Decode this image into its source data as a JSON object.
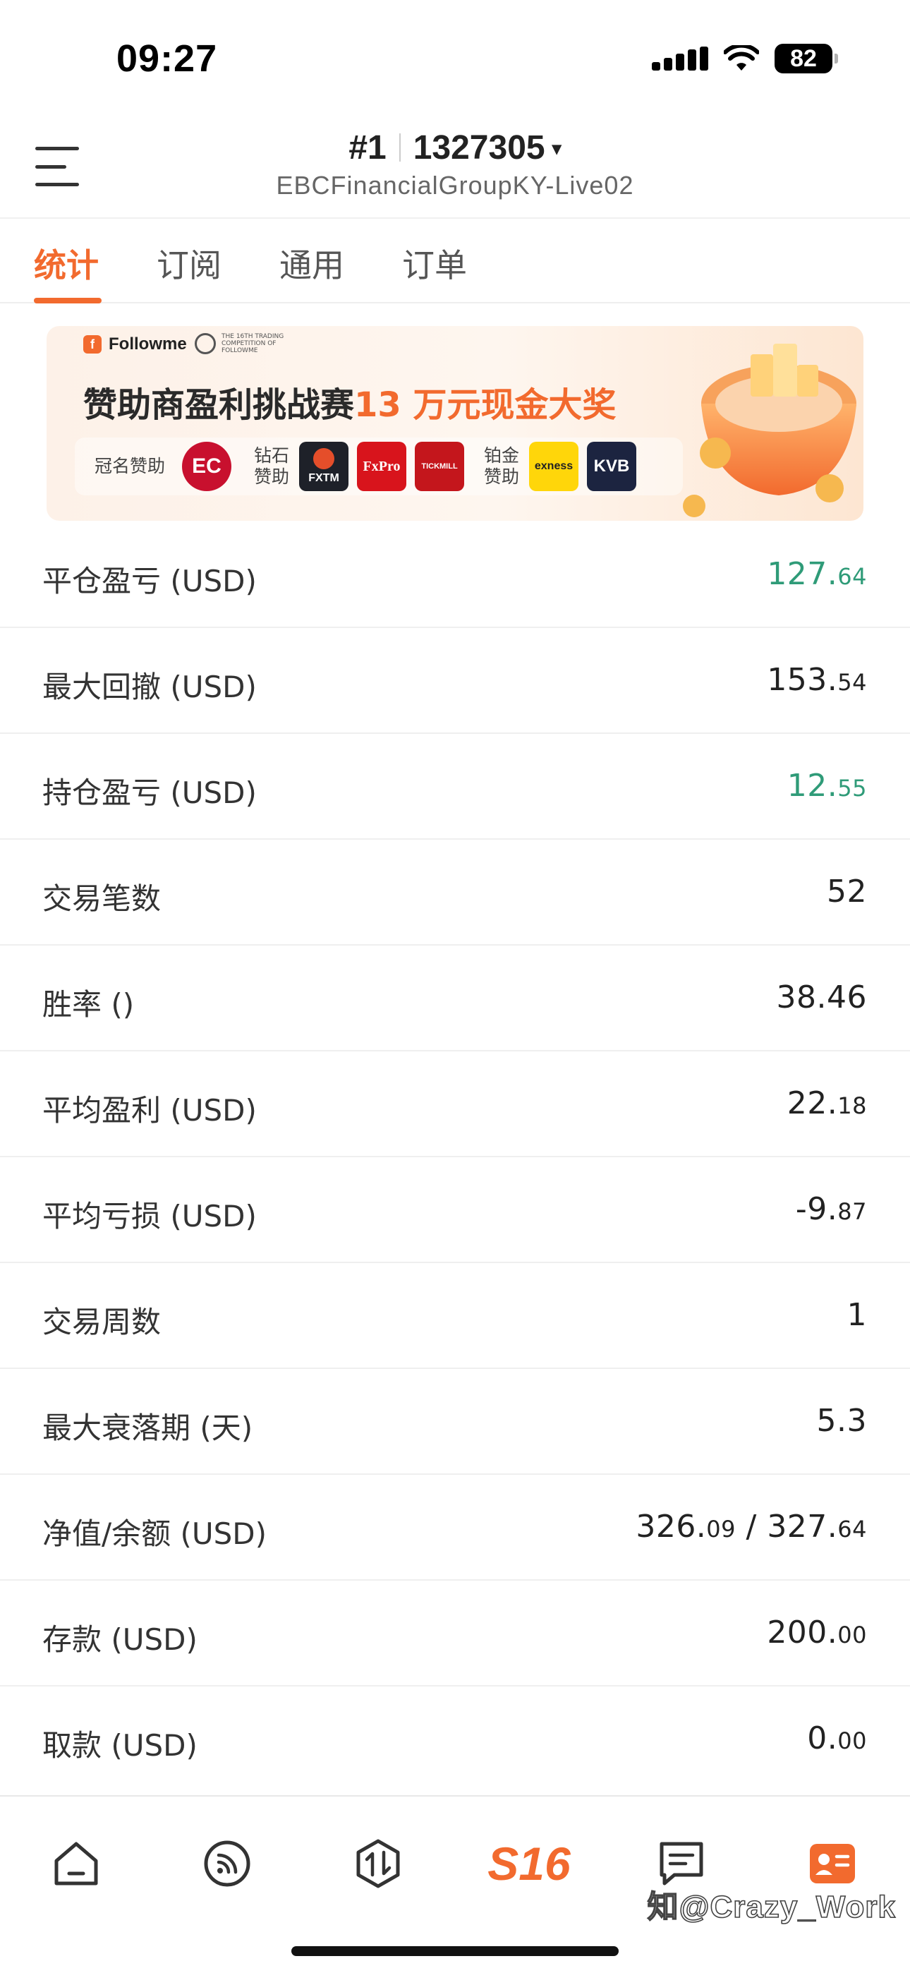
{
  "status_bar": {
    "time": "09:27",
    "battery": "82"
  },
  "header": {
    "account_prefix": "#1",
    "account_number": "1327305",
    "caret": "▾",
    "server": "EBCFinancialGroupKY-Live02"
  },
  "tabs": [
    {
      "label": "统计",
      "active": true
    },
    {
      "label": "订阅",
      "active": false
    },
    {
      "label": "通用",
      "active": false
    },
    {
      "label": "订单",
      "active": false
    }
  ],
  "banner": {
    "brand": "Followme",
    "competition_text": "THE 16TH TRADING COMPETITION OF FOLLOWME",
    "title_main": "赞助商盈利挑战赛",
    "title_highlight": "13 万元现金大奖",
    "title_sponsor_label": "冠名赞助",
    "diamond_label": "钻石赞助",
    "platinum_label": "铂金赞助",
    "sponsors": {
      "ec": "EC",
      "fxtm": "FXTM",
      "fxpro": "FxPro",
      "tickmill": "TICKMILL",
      "exness": "exness",
      "kvb": "KVB"
    }
  },
  "stats": [
    {
      "label": "平仓盈亏 (USD)",
      "int": "127.",
      "dec": "64",
      "color": "#2f9b78"
    },
    {
      "label": "最大回撤 (USD)",
      "int": "153.",
      "dec": "54",
      "color": "#222222"
    },
    {
      "label": "持仓盈亏 (USD)",
      "int": "12.",
      "dec": "55",
      "color": "#2f9b78"
    },
    {
      "label": "交易笔数",
      "int": "52",
      "dec": "",
      "color": "#222222"
    },
    {
      "label": "胜率 ()",
      "int": "38.46",
      "dec": "",
      "color": "#222222"
    },
    {
      "label": "平均盈利 (USD)",
      "int": "22.",
      "dec": "18",
      "color": "#222222"
    },
    {
      "label": "平均亏损 (USD)",
      "int": "-9.",
      "dec": "87",
      "color": "#222222"
    },
    {
      "label": "交易周数",
      "int": "1",
      "dec": "",
      "color": "#222222"
    },
    {
      "label": "最大衰落期 (天)",
      "int": "5.3",
      "dec": "",
      "color": "#222222"
    },
    {
      "label": "净值/余额 (USD)",
      "int": "326.",
      "dec": "09",
      "int2": " / 327.",
      "dec2": "64",
      "color": "#222222"
    },
    {
      "label": "存款 (USD)",
      "int": "200.",
      "dec": "00",
      "color": "#222222"
    },
    {
      "label": "取款 (USD)",
      "int": "0.",
      "dec": "00",
      "color": "#222222"
    }
  ],
  "bottom_nav": {
    "items": [
      "home-icon",
      "feed-icon",
      "trade-icon",
      "s16-icon",
      "message-icon",
      "profile-icon"
    ],
    "s16_label": "S16"
  },
  "watermark": "知@Crazy_Work",
  "colors": {
    "accent": "#f26a2e",
    "positive": "#2f9b78"
  }
}
